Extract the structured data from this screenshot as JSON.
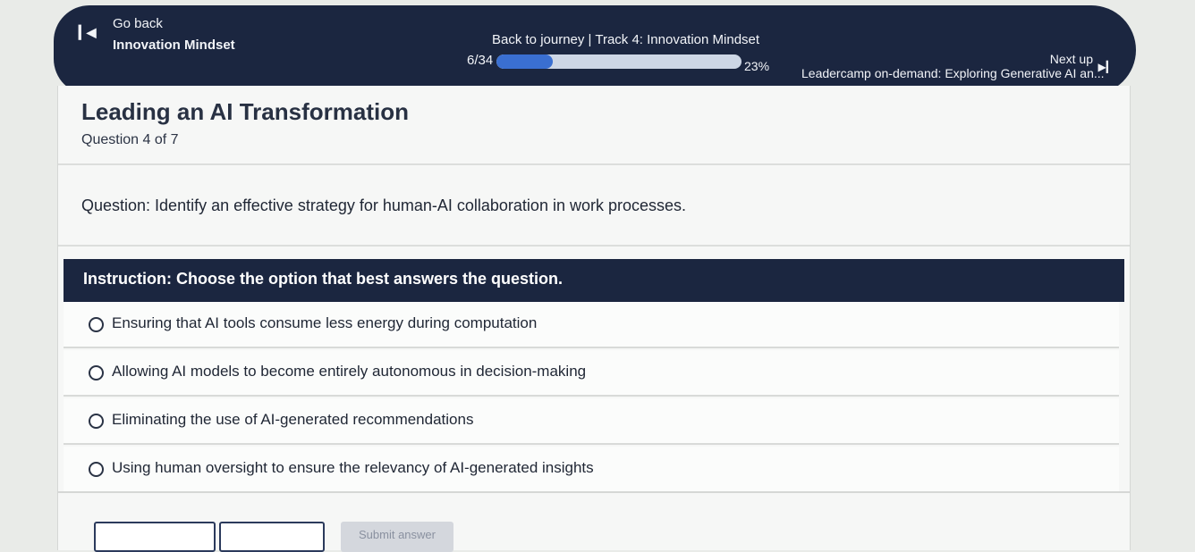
{
  "header": {
    "go_back": "Go back",
    "course_name": "Innovation Mindset",
    "track_info": "Back to journey  |  Track 4: Innovation Mindset",
    "progress_count": "6/34",
    "progress_percent": "23%",
    "progress_value": 0.23,
    "next_up_label": "Next up",
    "next_up_title": "Leadercamp on-demand: Exploring Generative AI an..."
  },
  "quiz": {
    "title": "Leading an AI Transformation",
    "question_count": "Question 4 of 7",
    "question": "Question: Identify an effective strategy for human-AI collaboration in work processes.",
    "instruction": "Instruction: Choose the option that best answers the question.",
    "options": [
      "Ensuring that AI tools consume less energy during computation",
      "Allowing AI models to become entirely autonomous in decision-making",
      "Eliminating the use of AI-generated recommendations",
      "Using human oversight to ensure the relevancy of AI-generated insights"
    ]
  },
  "actions": {
    "submit_label": "Submit answer"
  },
  "colors": {
    "header_bg": "#1b2640",
    "progress_fill": "#3a6fd1",
    "panel_bg": "#f6f7f6"
  },
  "icons": {
    "back": "skip-back-icon",
    "next": "skip-next-icon",
    "option": "radio-icon"
  }
}
